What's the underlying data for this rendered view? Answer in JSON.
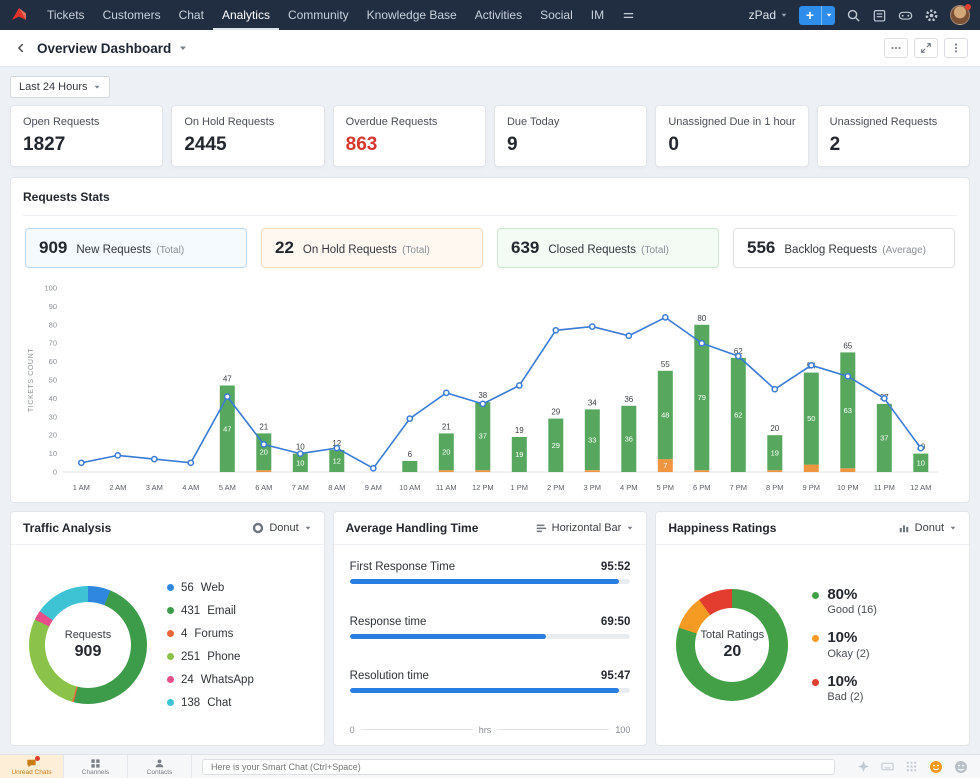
{
  "colors": {
    "accent": "#2e8ceb",
    "alert": "#d7372f",
    "bar_green": "#57a85e",
    "bar_orange": "#f0953f",
    "line_blue": "#3a7bd5"
  },
  "topnav": {
    "items": [
      "Tickets",
      "Customers",
      "Chat",
      "Analytics",
      "Community",
      "Knowledge Base",
      "Activities",
      "Social",
      "IM"
    ],
    "active_item": "Analytics",
    "workspace_label": "zPad"
  },
  "header": {
    "title": "Overview Dashboard"
  },
  "toolbar": {
    "time_filter": "Last 24 Hours"
  },
  "kpis": [
    {
      "label": "Open Requests",
      "value": "1827",
      "highlight": false
    },
    {
      "label": "On Hold Requests",
      "value": "2445",
      "highlight": false
    },
    {
      "label": "Overdue Requests",
      "value": "863",
      "highlight": true
    },
    {
      "label": "Due Today",
      "value": "9",
      "highlight": false
    },
    {
      "label": "Unassigned Due in 1 hour",
      "value": "0",
      "highlight": false
    },
    {
      "label": "Unassigned Requests",
      "value": "2",
      "highlight": false
    }
  ],
  "requests_stats": {
    "title": "Requests Stats",
    "summary": [
      {
        "value": "909",
        "label": "New Requests",
        "qualifier": "(Total)",
        "theme": "blue"
      },
      {
        "value": "22",
        "label": "On Hold Requests",
        "qualifier": "(Total)",
        "theme": "orange"
      },
      {
        "value": "639",
        "label": "Closed Requests",
        "qualifier": "(Total)",
        "theme": "green"
      },
      {
        "value": "556",
        "label": "Backlog Requests",
        "qualifier": "(Average)",
        "theme": "plain"
      }
    ]
  },
  "chart_data": [
    {
      "id": "requests-stats-timeline",
      "type": "bar",
      "title": "Requests Stats",
      "ylabel": "TICKETS COUNT",
      "ylim": [
        0,
        100
      ],
      "yticks": [
        0,
        10,
        20,
        30,
        40,
        50,
        60,
        70,
        80,
        90,
        100
      ],
      "grid": false,
      "legend_position": "none",
      "categories": [
        "1 AM",
        "2 AM",
        "3 AM",
        "4 AM",
        "5 AM",
        "6 AM",
        "7 AM",
        "8 AM",
        "9 AM",
        "10 AM",
        "11 AM",
        "12 PM",
        "1 PM",
        "2 PM",
        "3 PM",
        "4 PM",
        "5 PM",
        "6 PM",
        "7 PM",
        "8 PM",
        "9 PM",
        "10 PM",
        "11 PM",
        "12 AM"
      ],
      "series": [
        {
          "name": "On Hold Requests",
          "type": "bar",
          "color": "#f0953f",
          "values": [
            0,
            0,
            0,
            0,
            0,
            1,
            0,
            0,
            0,
            0,
            1,
            1,
            0,
            0,
            1,
            0,
            7,
            1,
            0,
            1,
            4,
            2,
            0,
            0
          ]
        },
        {
          "name": "Closed Requests",
          "type": "bar",
          "color": "#57a85e",
          "values": [
            0,
            0,
            0,
            0,
            47,
            20,
            10,
            12,
            0,
            6,
            20,
            37,
            19,
            29,
            33,
            36,
            48,
            79,
            62,
            19,
            50,
            63,
            37,
            10
          ]
        },
        {
          "name": "New Requests",
          "type": "line",
          "color": "#3a7bd5",
          "values": [
            5,
            9,
            7,
            5,
            41,
            15,
            10,
            13,
            2,
            29,
            43,
            37,
            47,
            77,
            79,
            74,
            84,
            70,
            63,
            45,
            58,
            52,
            40,
            13
          ]
        }
      ]
    },
    {
      "id": "traffic-analysis",
      "type": "pie",
      "title": "Traffic Analysis",
      "view_selector": "Donut",
      "center_label": "Requests",
      "center_value": "909",
      "segments": [
        {
          "label": "Web",
          "value": 56,
          "color": "#2f87e0"
        },
        {
          "label": "Email",
          "value": 431,
          "color": "#3d9c49"
        },
        {
          "label": "Forums",
          "value": 4,
          "color": "#f0683c"
        },
        {
          "label": "Phone",
          "value": 251,
          "color": "#8bc34a"
        },
        {
          "label": "WhatsApp",
          "value": 24,
          "color": "#e84f8a"
        },
        {
          "label": "Chat",
          "value": 138,
          "color": "#3ec3d5"
        }
      ]
    },
    {
      "id": "average-handling-time",
      "type": "bar",
      "orientation": "horizontal",
      "title": "Average Handling Time",
      "view_selector": "Horizontal Bar",
      "color": "#2a7de1",
      "xlim": [
        0,
        100
      ],
      "axis": {
        "min": "0",
        "unit": "hrs",
        "max": "100"
      },
      "rows": [
        {
          "label": "First Response Time",
          "value_label": "95:52",
          "value": 95.9
        },
        {
          "label": "Response time",
          "value_label": "69:50",
          "value": 69.8
        },
        {
          "label": "Resolution time",
          "value_label": "95:47",
          "value": 95.8
        }
      ]
    },
    {
      "id": "happiness-ratings",
      "type": "pie",
      "title": "Happiness Ratings",
      "view_selector": "Donut",
      "center_label": "Total Ratings",
      "center_value": "20",
      "segments": [
        {
          "label": "Good",
          "pct": "80%",
          "count_label": "Good (16)",
          "value": 16,
          "color": "#43a047"
        },
        {
          "label": "Okay",
          "pct": "10%",
          "count_label": "Okay (2)",
          "value": 2,
          "color": "#f59a23"
        },
        {
          "label": "Bad",
          "pct": "10%",
          "count_label": "Bad (2)",
          "value": 2,
          "color": "#e23d2e"
        }
      ]
    }
  ],
  "chat_bar": {
    "tabs": [
      {
        "label": "Unread Chats",
        "active": true
      },
      {
        "label": "Channels",
        "active": false
      },
      {
        "label": "Contacts",
        "active": false
      }
    ],
    "input_placeholder": "Here is your Smart Chat (Ctrl+Space)"
  }
}
